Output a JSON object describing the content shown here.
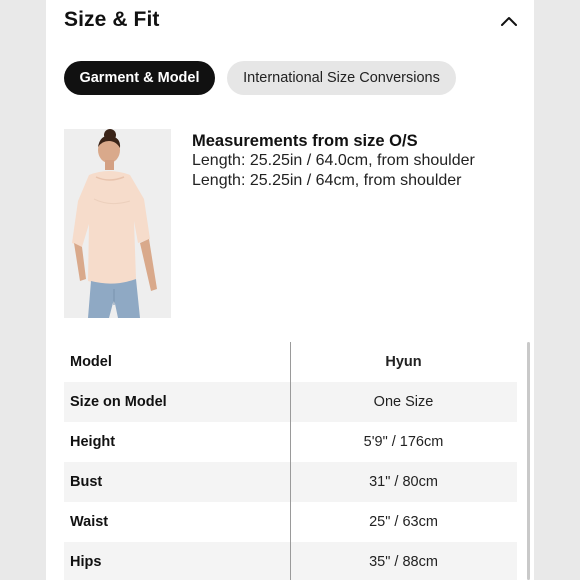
{
  "header": {
    "title": "Size & Fit",
    "collapse_icon": "chevron-up-icon"
  },
  "tabs": [
    {
      "label": "Garment & Model",
      "active": true
    },
    {
      "label": "International Size Conversions",
      "active": false
    }
  ],
  "measurements": {
    "title": "Measurements from size O/S",
    "lines": [
      "Length: 25.25in / 64.0cm, from shoulder",
      "Length: 25.25in / 64cm, from shoulder"
    ]
  },
  "model_table": {
    "rows": [
      {
        "label": "Model",
        "value": "Hyun"
      },
      {
        "label": "Size on Model",
        "value": "One Size"
      },
      {
        "label": "Height",
        "value": "5'9\" / 176cm"
      },
      {
        "label": "Bust",
        "value": "31\" / 80cm"
      },
      {
        "label": "Waist",
        "value": "25\" / 63cm"
      },
      {
        "label": "Hips",
        "value": "35\" / 88cm"
      }
    ]
  },
  "colors": {
    "active_tab_bg": "#111111",
    "inactive_tab_bg": "#e6e6e6",
    "shaded_row": "#f4f4f4"
  }
}
